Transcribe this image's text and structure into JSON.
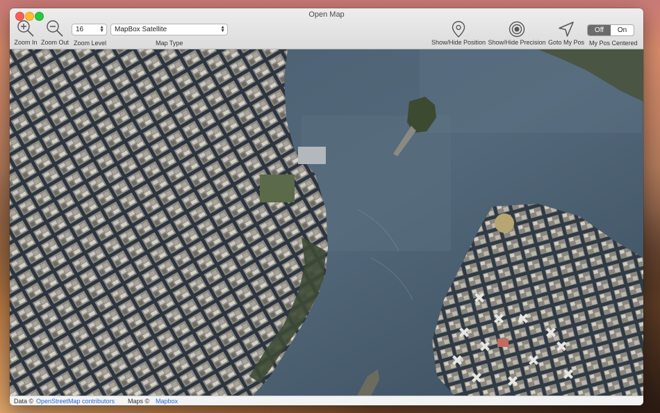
{
  "window": {
    "title": "Open Map"
  },
  "toolbar": {
    "zoom_in_label": "Zoom In",
    "zoom_out_label": "Zoom Out",
    "zoom_level_label": "Zoom Level",
    "zoom_level_value": "16",
    "map_type_label": "Map Type",
    "map_type_value": "MapBox Satellite",
    "show_hide_position_label": "Show/Hide Position",
    "show_hide_precision_label": "Show/Hide Precision",
    "goto_my_pos_label": "Goto My Pos",
    "my_pos_centered_label": "My Pos Centered",
    "toggle_off": "Off",
    "toggle_on": "On",
    "toggle_selected": "Off"
  },
  "icons": {
    "zoom_in": "zoom-in-icon",
    "zoom_out": "zoom-out-icon",
    "position": "location-pin-icon",
    "precision": "target-icon",
    "goto": "navigation-arrow-icon"
  },
  "status": {
    "data_prefix": "Data ©",
    "data_link": "OpenStreetMap contributors",
    "maps_prefix": "Maps ©",
    "maps_link": "Mapbox"
  },
  "colors": {
    "link": "#2a6ad8",
    "water": "#3f5566",
    "segment_selected": "#6b6b6b"
  }
}
